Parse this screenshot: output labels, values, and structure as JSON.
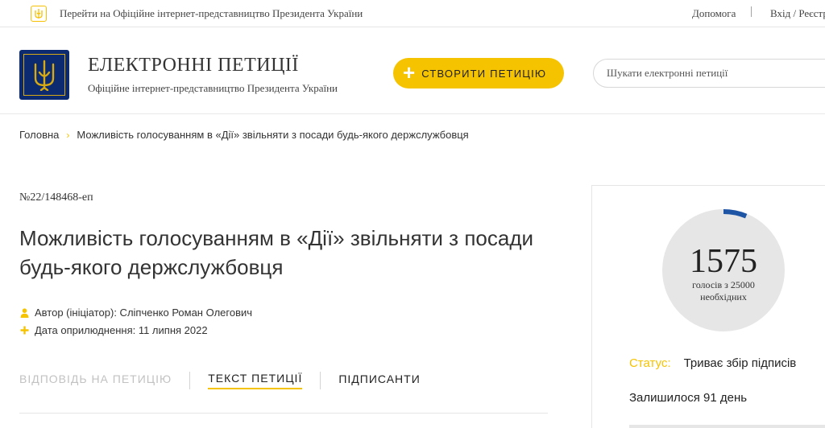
{
  "topbar": {
    "president_link": "Перейти на Офіційне інтернет-представництво Президента України",
    "help": "Допомога",
    "separator": "|",
    "login": "Вхід / Реєстрація"
  },
  "header": {
    "title": "ЕЛЕКТРОННІ ПЕТИЦІЇ",
    "subtitle": "Офіційне інтернет-представництво Президента України",
    "create_button": "СТВОРИТИ ПЕТИЦІЮ",
    "search_placeholder": "Шукати електронні петиції"
  },
  "breadcrumb": {
    "home": "Головна",
    "separator": "›",
    "current": "Можливість голосуванням в «Дії» звільняти з посади будь-якого держслужбовця"
  },
  "petition": {
    "number": "№22/148468-еп",
    "title": "Можливість голосуванням в «Дії» звільняти з посади будь-якого держслужбовця",
    "author": "Автор (ініціатор): Сліпченко Роман Олегович",
    "date": "Дата оприлюднення: 11 липня 2022"
  },
  "tabs": [
    {
      "label": "ВІДПОВІДЬ НА ПЕТИЦІЮ",
      "state": "disabled"
    },
    {
      "label": "ТЕКСТ ПЕТИЦІЇ",
      "state": "active"
    },
    {
      "label": "ПІДПИСАНТИ",
      "state": "normal"
    }
  ],
  "sidebar": {
    "votes": 1575,
    "votes_label": "голосів з 25000 необхідних",
    "votes_needed": 25000,
    "progress_fraction": 0.063,
    "status_label": "Статус:",
    "status_value": "Триває збір підписів",
    "remaining": "Залишилося 91 день"
  },
  "colors": {
    "accent": "#f6c300",
    "progress": "#1f55a5",
    "circle": "#e6e6e6",
    "logo_bg": "#0b2a6f"
  },
  "icons": {
    "topbar": "trident-icon",
    "logo": "trident-emblem-icon",
    "create": "plus-icon",
    "author": "person-icon",
    "date": "plus-icon"
  }
}
